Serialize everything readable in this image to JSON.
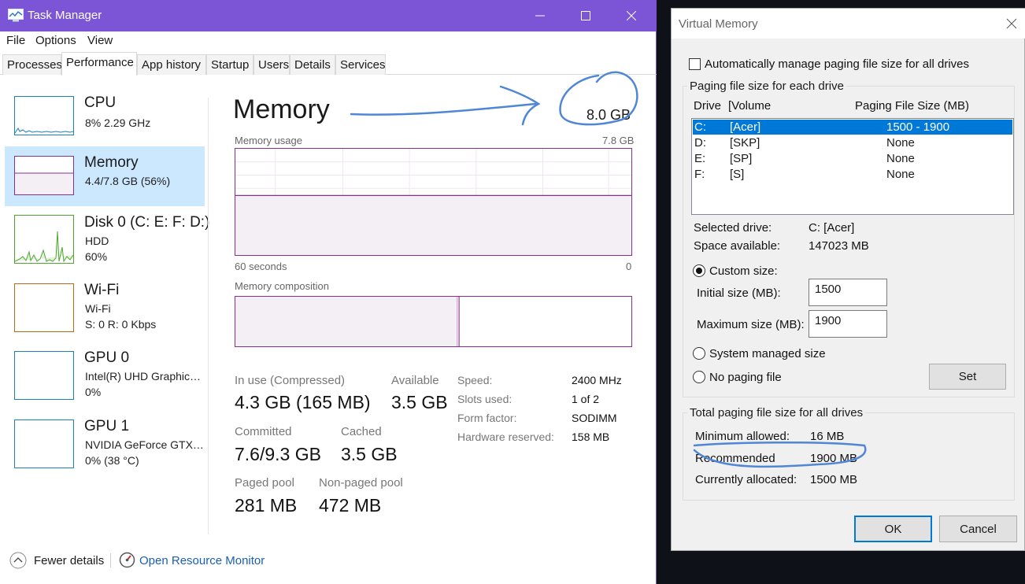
{
  "colors": {
    "accent": "#7b55d6",
    "memory_line": "#8b2f8f",
    "cpu_line": "#1b7fbb",
    "disk_line": "#4da72e",
    "wifi_line": "#b86a17",
    "gpu_line": "#1b7fbb",
    "selection": "#cce8ff",
    "list_selection": "#0078d7",
    "annotation": "#4f86d6"
  },
  "task_manager": {
    "title": "Task Manager",
    "menu": [
      "File",
      "Options",
      "View"
    ],
    "tabs": [
      "Processes",
      "Performance",
      "App history",
      "Startup",
      "Users",
      "Details",
      "Services"
    ],
    "active_tab": "Performance",
    "sidebar": [
      {
        "name": "CPU",
        "lines": [
          "8%  2.29 GHz"
        ]
      },
      {
        "name": "Memory",
        "lines": [
          "4.4/7.8 GB (56%)"
        ]
      },
      {
        "name": "Disk 0 (C: E: F: D:)",
        "lines": [
          "HDD",
          "60%"
        ]
      },
      {
        "name": "Wi-Fi",
        "lines": [
          "Wi-Fi",
          "S: 0  R: 0 Kbps"
        ]
      },
      {
        "name": "GPU 0",
        "lines": [
          "Intel(R) UHD Graphic…",
          "0%"
        ]
      },
      {
        "name": "GPU 1",
        "lines": [
          "NVIDIA GeForce GTX…",
          "0%  (38 °C)"
        ]
      }
    ],
    "memory": {
      "title": "Memory",
      "total": "8.0 GB",
      "usage_label": "Memory usage",
      "usage_max": "7.8 GB",
      "time_left": "60 seconds",
      "time_right": "0",
      "composition_label": "Memory composition",
      "usage_fraction": 0.56,
      "in_use_fraction": 0.56,
      "modified_fraction": 0.005,
      "stats": {
        "in_use_label": "In use (Compressed)",
        "in_use_value": "4.3 GB (165 MB)",
        "available_label": "Available",
        "available_value": "3.5 GB",
        "committed_label": "Committed",
        "committed_value": "7.6/9.3 GB",
        "cached_label": "Cached",
        "cached_value": "3.5 GB",
        "paged_label": "Paged pool",
        "paged_value": "281 MB",
        "nonpaged_label": "Non-paged pool",
        "nonpaged_value": "472 MB"
      },
      "specs": [
        {
          "label": "Speed:",
          "value": "2400 MHz"
        },
        {
          "label": "Slots used:",
          "value": "1 of 2"
        },
        {
          "label": "Form factor:",
          "value": "SODIMM"
        },
        {
          "label": "Hardware reserved:",
          "value": "158 MB"
        }
      ]
    },
    "footer": {
      "fewer_details": "Fewer details",
      "open_monitor": "Open Resource Monitor"
    }
  },
  "virtual_memory": {
    "title": "Virtual Memory",
    "auto_manage": "Automatically manage paging file size for all drives",
    "auto_manage_checked": false,
    "group1_label": "Paging file size for each drive",
    "col_drive": "Drive",
    "col_volume": "[Volume",
    "col_size": "Paging File Size (MB)",
    "drives": [
      {
        "drive": "C:",
        "volume": "[Acer]",
        "size": "1500 - 1900",
        "selected": true
      },
      {
        "drive": "D:",
        "volume": "[SKP]",
        "size": "None",
        "selected": false
      },
      {
        "drive": "E:",
        "volume": "[SP]",
        "size": "None",
        "selected": false
      },
      {
        "drive": "F:",
        "volume": "[S]",
        "size": "None",
        "selected": false
      }
    ],
    "selected_drive_label": "Selected drive:",
    "selected_drive_value": "C:  [Acer]",
    "space_label": "Space available:",
    "space_value": "147023 MB",
    "custom_size": "Custom size:",
    "initial_label": "Initial size (MB):",
    "initial_value": "1500",
    "maximum_label": "Maximum size (MB):",
    "maximum_value": "1900",
    "system_managed": "System managed size",
    "no_paging": "No paging file",
    "set_button": "Set",
    "group2_label": "Total paging file size for all drives",
    "min_label": "Minimum allowed:",
    "min_value": "16 MB",
    "rec_label": "Recommended",
    "rec_value": "1900 MB",
    "cur_label": "Currently allocated:",
    "cur_value": "1500 MB",
    "ok": "OK",
    "cancel": "Cancel"
  }
}
